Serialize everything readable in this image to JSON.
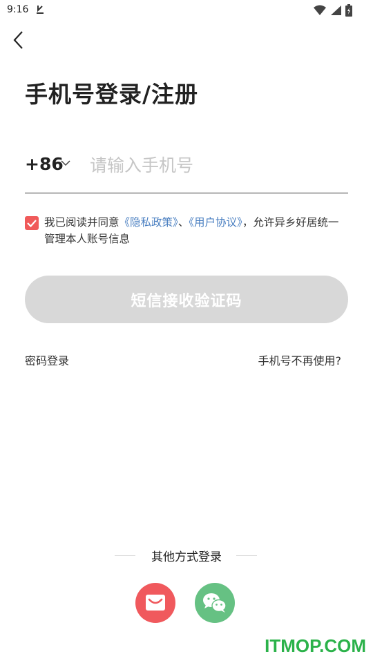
{
  "status_bar": {
    "time": "9:16"
  },
  "page": {
    "title": "手机号登录/注册"
  },
  "phone": {
    "country_code": "+86",
    "placeholder": "请输入手机号",
    "value": ""
  },
  "agreement": {
    "checked": true,
    "prefix": "我已阅读并同意",
    "privacy_link": "《隐私政策》",
    "separator": "、",
    "terms_link": "《用户协议》",
    "suffix": "，允许异乡好居统一管理本人账号信息"
  },
  "sms_button": {
    "label": "短信接收验证码"
  },
  "links": {
    "password_login": "密码登录",
    "phone_unused": "手机号不再使用?"
  },
  "other_login": {
    "label": "其他方式登录",
    "methods": [
      {
        "icon": "mail-icon",
        "color": "#f0595d"
      },
      {
        "icon": "wechat-icon",
        "color": "#66c183"
      }
    ]
  },
  "watermark": "ITMOP.COM",
  "colors": {
    "accent": "#f05a5a",
    "link": "#4a7fc1",
    "button_disabled": "#d8d8d8",
    "wechat": "#66c183",
    "watermark": "#2bb24a"
  }
}
